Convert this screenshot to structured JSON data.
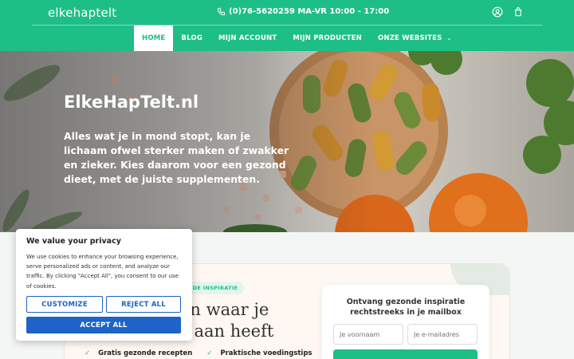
{
  "header": {
    "logo": "elkehaptelt",
    "contact": "(0)76-5620259 MA-VR 10:00 - 17:00",
    "icons": [
      "phone-icon",
      "user-icon",
      "cart-icon"
    ]
  },
  "nav": {
    "items": [
      {
        "label": "HOME",
        "active": true
      },
      {
        "label": "BLOG"
      },
      {
        "label": "MIJN ACCOUNT"
      },
      {
        "label": "MIJN PRODUCTEN"
      },
      {
        "label": "ONZE WEBSITES"
      }
    ]
  },
  "hero": {
    "title": "ElkeHapTelt.nl",
    "text": "Alles wat je in mond stopt, kan je lichaam ofwel sterker maken of zwakker en zieker. Kies daarom voor een gezond dieet, met de juiste supplementen."
  },
  "promo": {
    "pill": "NDE INSPIRATIE",
    "title_line1": "en waar je",
    "title_line2": "s aan heeft",
    "features": [
      "Gratis gezonde recepten",
      "Praktische voedingstips"
    ]
  },
  "newsletter": {
    "title_line1": "Ontvang gezonde inspiratie",
    "title_line2": "rechtstreeks in je mailbox",
    "name_placeholder": "Je voornaam",
    "email_placeholder": "Je e-mailadres"
  },
  "cookie": {
    "title": "We value your privacy",
    "text": "We use cookies to enhance your browsing experience, serve personalized ads or content, and analyze our traffic. By clicking \"Accept All\", you consent to our use of cookies.",
    "customize": "CUSTOMIZE",
    "reject": "REJECT ALL",
    "accept": "ACCEPT ALL"
  },
  "colors": {
    "brand": "#1dbf87",
    "cookie_button": "#1d63c9"
  }
}
